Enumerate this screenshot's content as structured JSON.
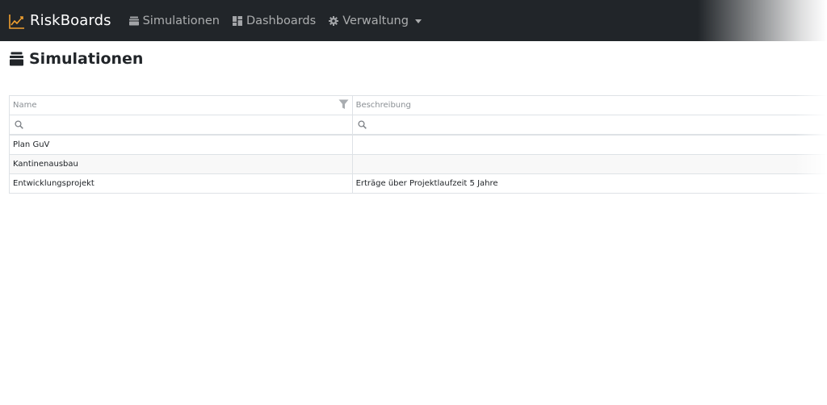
{
  "navbar": {
    "brand": "RiskBoards",
    "items": [
      {
        "label": "Simulationen",
        "icon": "database-stack-icon"
      },
      {
        "label": "Dashboards",
        "icon": "dashboard-grid-icon"
      },
      {
        "label": "Verwaltung",
        "icon": "gear-icon",
        "dropdown": true
      }
    ],
    "colors": {
      "background": "#212529",
      "brand_icon": "#f0a030",
      "link": "#a3a5a8"
    }
  },
  "page": {
    "title": "Simulationen",
    "title_icon": "database-stack-icon"
  },
  "table": {
    "columns": [
      {
        "header": "Name",
        "filter_placeholder": ""
      },
      {
        "header": "Beschreibung",
        "filter_placeholder": ""
      }
    ],
    "rows": [
      {
        "name": "Plan GuV",
        "description": ""
      },
      {
        "name": "Kantinenausbau",
        "description": ""
      },
      {
        "name": "Entwicklungsprojekt",
        "description": "Erträge über Projektlaufzeit 5 Jahre"
      }
    ]
  }
}
